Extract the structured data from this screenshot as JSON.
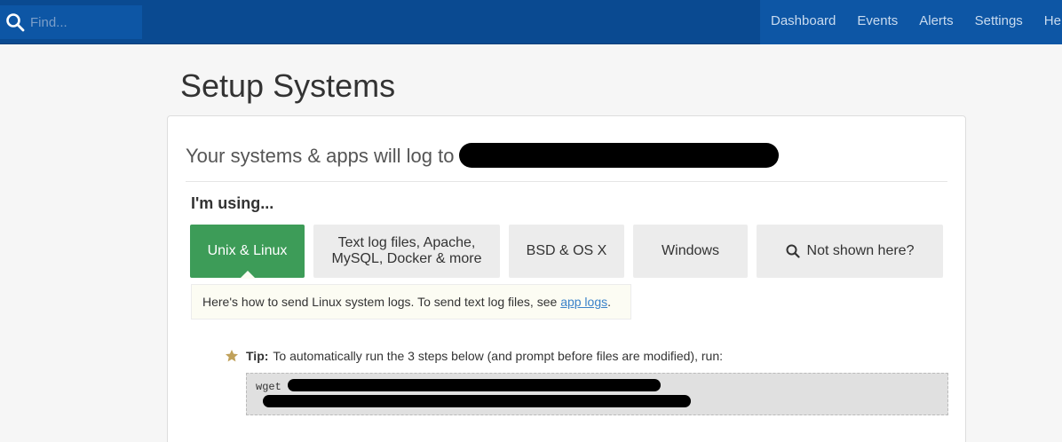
{
  "search": {
    "placeholder": "Find..."
  },
  "nav": {
    "items": [
      {
        "label": "Dashboard"
      },
      {
        "label": "Events"
      },
      {
        "label": "Alerts"
      },
      {
        "label": "Settings"
      },
      {
        "label": "Help"
      }
    ]
  },
  "page": {
    "title": "Setup Systems"
  },
  "panel": {
    "heading": "Your systems & apps will log to",
    "using_label": "I'm using...",
    "options": [
      {
        "label": "Unix & Linux",
        "active": true
      },
      {
        "label": "Text log files, Apache, MySQL, Docker & more",
        "active": false
      },
      {
        "label": "BSD & OS X",
        "active": false
      },
      {
        "label": "Windows",
        "active": false
      },
      {
        "label": "Not shown here?",
        "icon": "search-icon",
        "active": false
      }
    ],
    "hint": {
      "text": "Here's how to send Linux system logs. To send text log files, see ",
      "link": "app logs",
      "suffix": "."
    },
    "tip": {
      "label": "Tip:",
      "text": "To automatically run the 3 steps below (and prompt before files are modified), run:"
    },
    "code": {
      "command": "wget"
    }
  },
  "colors": {
    "topbar": "#0a4a91",
    "accent_green": "#3d9c58",
    "link": "#3a82c9",
    "star": "#c0a15a"
  }
}
